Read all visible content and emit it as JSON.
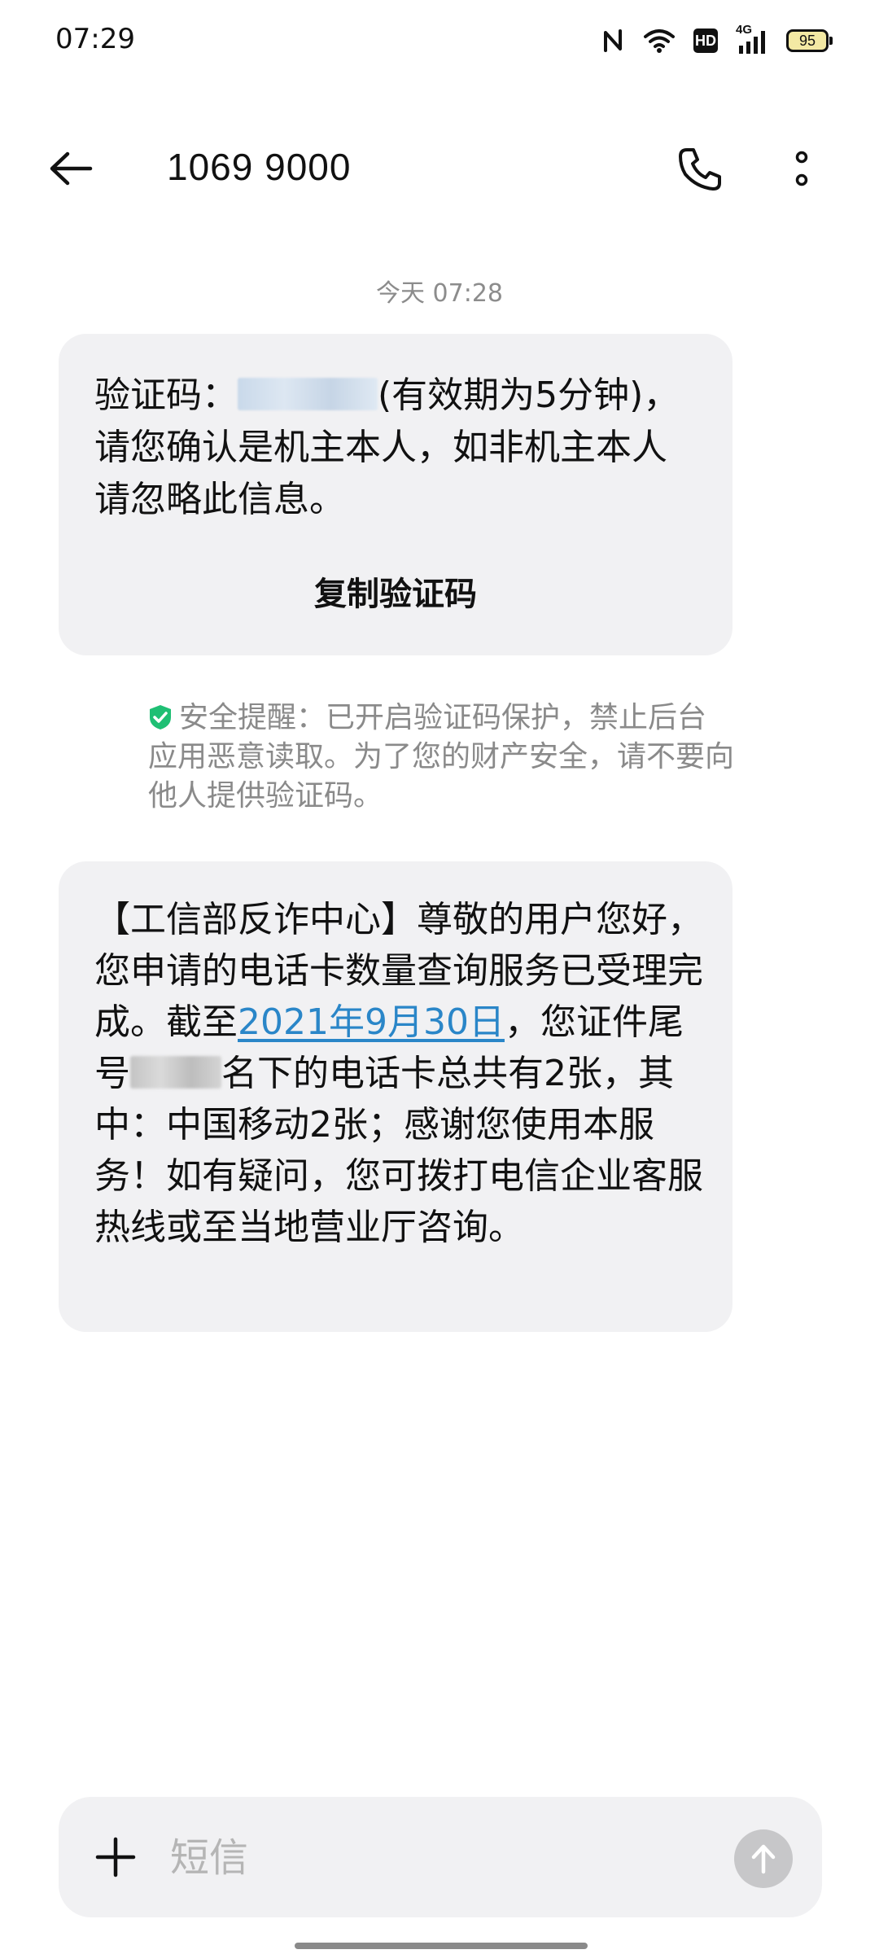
{
  "status_bar": {
    "time": "07:29",
    "hd_label": "HD",
    "network_label": "4G",
    "battery_level": "95",
    "icons": [
      "nfc-icon",
      "wifi-icon",
      "hd-icon",
      "signal-icon",
      "battery-icon"
    ]
  },
  "header": {
    "title": "1069 9000",
    "back_icon": "arrow-left-icon",
    "call_icon": "phone-icon",
    "more_icon": "more-vertical-icon"
  },
  "conversation": {
    "timestamp": "今天 07:28",
    "message1": {
      "prefix": "验证码：",
      "after_code": "(有效期为5分钟)，请您确认是机主本人，如非机主本人请忽略此信息。",
      "copy_button": "复制验证码"
    },
    "security_notice": "安全提醒：已开启验证码保护，禁止后台应用恶意读取。为了您的财产安全，请不要向他人提供验证码。",
    "message2": {
      "part1": "【工信部反诈中心】尊敬的用户您好，您申请的电话卡数量查询服务已受理完成。截至",
      "date_link": "2021年9月30日",
      "part2": "，您证件尾号",
      "part3": "名下的电话卡总共有2张，其中：中国移动2张；感谢您使用本服务！如有疑问，您可拨打电信企业客服热线或至当地营业厅咨询。"
    }
  },
  "composer": {
    "placeholder": "短信",
    "add_icon": "plus-icon",
    "send_icon": "send-arrow-up-icon"
  },
  "colors": {
    "bubble_bg": "#f1f1f3",
    "link": "#2a86c8",
    "shield": "#1fbf74",
    "muted_text": "#8a8a8a"
  }
}
